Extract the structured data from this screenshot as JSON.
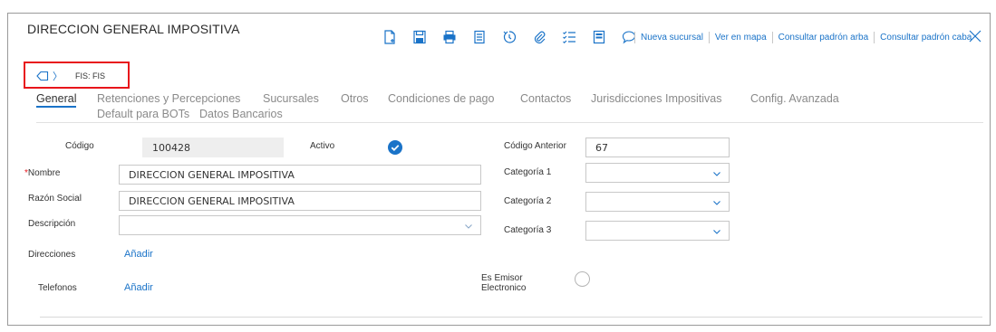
{
  "header": {
    "title": "DIRECCION GENERAL IMPOSITIVA",
    "toolbar_icons": [
      "new-document-icon",
      "save-icon",
      "print-icon",
      "duplicate-icon",
      "history-icon",
      "attach-icon",
      "checklist-icon",
      "notes-icon",
      "comment-icon"
    ],
    "links": [
      "Nueva sucursal",
      "Ver en mapa",
      "Consultar padrón arba",
      "Consultar padrón caba"
    ]
  },
  "breadcrumb": {
    "label": "FIS: FIS"
  },
  "tabs": [
    "General",
    "Retenciones y Percepciones",
    "Sucursales",
    "Otros",
    "Condiciones de pago",
    "Contactos",
    "Jurisdicciones Impositivas",
    "Config. Avanzada",
    "Default para BOTs",
    "Datos Bancarios"
  ],
  "form": {
    "codigo_label": "Código",
    "codigo_value": "100428",
    "activo_label": "Activo",
    "nombre_label": "Nombre",
    "nombre_value": "DIRECCION GENERAL IMPOSITIVA",
    "razon_label": "Razón Social",
    "razon_value": "DIRECCION GENERAL IMPOSITIVA",
    "descripcion_label": "Descripción",
    "descripcion_value": "",
    "direcciones_label": "Direcciones",
    "direcciones_link": "Añadir",
    "telefonos_label": "Telefonos",
    "telefonos_link": "Añadir",
    "codigo_anterior_label": "Código Anterior",
    "codigo_anterior_value": "67",
    "categoria1_label": "Categoría 1",
    "categoria2_label": "Categoría 2",
    "categoria3_label": "Categoría 3",
    "emisor_label_1": "Es Emisor",
    "emisor_label_2": "Electronico"
  },
  "colors": {
    "accent": "#1a73c8",
    "highlight_box": "#e8151b",
    "required": "#e8151b"
  }
}
